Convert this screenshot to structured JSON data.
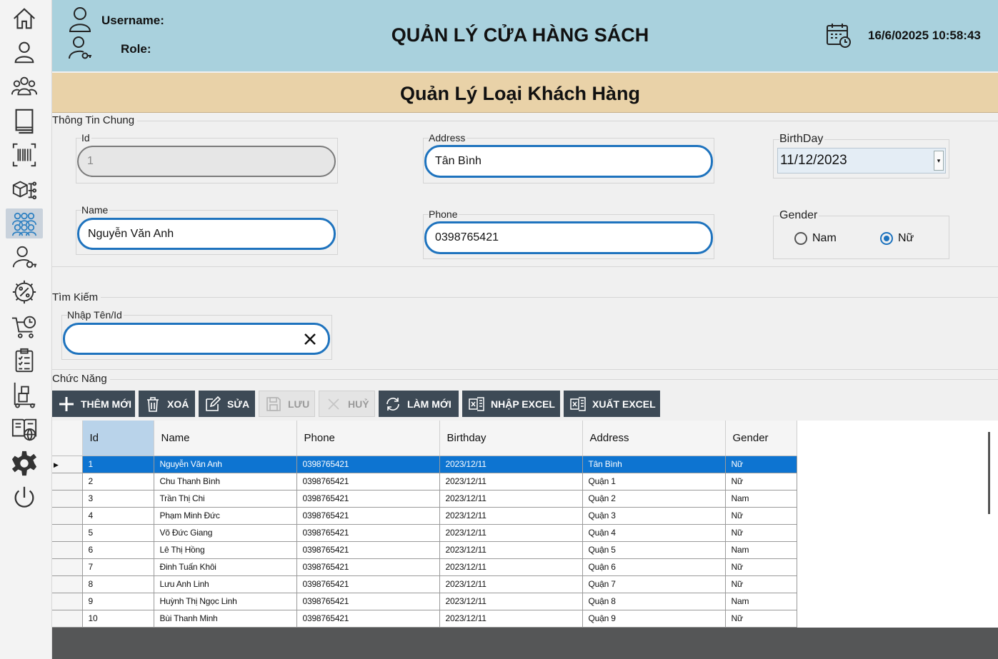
{
  "header": {
    "username_label": "Username:",
    "role_label": "Role:",
    "app_title": "QUẢN LÝ CỬA HÀNG SÁCH",
    "datetime": "16/6/02025 10:58:43"
  },
  "page_title": "Quản Lý Loại Khách Hàng",
  "general_info": {
    "group_title": "Thông Tin Chung",
    "id_label": "Id",
    "id_value": "1",
    "name_label": "Name",
    "name_value": "Nguyễn Văn Anh",
    "address_label": "Address",
    "address_value": "Tân Bình",
    "phone_label": "Phone",
    "phone_value": "0398765421",
    "birthday_label": "BirthDay",
    "birthday_value": "11/12/2023",
    "gender_label": "Gender",
    "gender_male": "Nam",
    "gender_female": "Nữ",
    "gender_selected": "Nữ"
  },
  "search": {
    "group_title": "Tìm Kiếm",
    "input_label": "Nhập Tên/Id",
    "input_value": ""
  },
  "functions": {
    "group_title": "Chức Năng",
    "add": "THÊM MỚI",
    "delete": "XOÁ",
    "edit": "SỬA",
    "save": "LƯU",
    "cancel": "HUỶ",
    "refresh": "LÀM MỚI",
    "import_excel": "NHẬP EXCEL",
    "export_excel": "XUẤT EXCEL"
  },
  "grid": {
    "columns": [
      "Id",
      "Name",
      "Phone",
      "Birthday",
      "Address",
      "Gender"
    ],
    "rows": [
      [
        "1",
        "Nguyễn Văn Anh",
        "0398765421",
        "2023/12/11",
        "Tân Bình",
        "Nữ"
      ],
      [
        "2",
        "Chu Thanh Bình",
        "0398765421",
        "2023/12/11",
        "Quận 1",
        "Nữ"
      ],
      [
        "3",
        "Trần  Thị Chi",
        "0398765421",
        "2023/12/11",
        "Quận 2",
        "Nam"
      ],
      [
        "4",
        "Phạm Minh Đức",
        "0398765421",
        "2023/12/11",
        "Quận 3",
        "Nữ"
      ],
      [
        "5",
        "Võ Đức Giang",
        "0398765421",
        "2023/12/11",
        "Quận 4",
        "Nữ"
      ],
      [
        "6",
        "Lê Thị Hồng",
        "0398765421",
        "2023/12/11",
        "Quận 5",
        "Nam"
      ],
      [
        "7",
        "Đinh  Tuấn Khôi",
        "0398765421",
        "2023/12/11",
        "Quận 6",
        "Nữ"
      ],
      [
        "8",
        "Lưu  Anh Linh",
        "0398765421",
        "2023/12/11",
        "Quận 7",
        "Nữ"
      ],
      [
        "9",
        "Huỳnh Thị Ngọc Linh",
        "0398765421",
        "2023/12/11",
        "Quận 8",
        "Nam"
      ],
      [
        "10",
        "Bùi Thanh Minh",
        "0398765421",
        "2023/12/11",
        "Quận 9",
        "Nữ"
      ]
    ],
    "selected_row": 0
  },
  "sidebar": {
    "items": [
      "home-icon",
      "user-icon",
      "group-icon",
      "book-icon",
      "barcode-icon",
      "category-icon",
      "customer-type-icon",
      "user-key-icon",
      "discount-gear-icon",
      "cart-time-icon",
      "clipboard-list-icon",
      "warehouse-icon",
      "web-book-icon",
      "settings-icon",
      "power-icon"
    ],
    "active_index": 6
  },
  "colors": {
    "header_bg": "#a9d1dd",
    "title_band_bg": "#e9d2a8",
    "accent": "#1e73be",
    "toolbar_button": "#3d4a56",
    "selected_row": "#0d74d1"
  }
}
